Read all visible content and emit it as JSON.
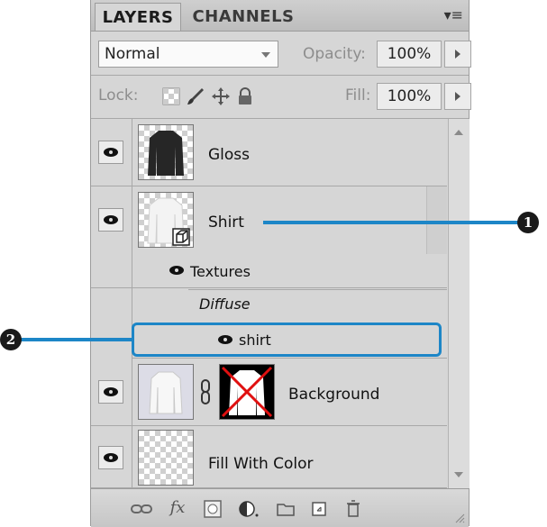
{
  "panel": {
    "tabs": [
      "LAYERS",
      "CHANNELS"
    ],
    "blend_mode": "Normal",
    "opacity_label": "Opacity:",
    "opacity_value": "100%",
    "lock_label": "Lock:",
    "fill_label": "Fill:",
    "fill_value": "100%"
  },
  "layers": [
    {
      "name": "Gloss",
      "visible": true
    },
    {
      "name": "Shirt",
      "visible": true,
      "smart_object": true,
      "sub": {
        "group": "Textures",
        "channel": "Diffuse",
        "texture": "shirt"
      }
    },
    {
      "name": "Background",
      "visible": true,
      "has_mask": true
    },
    {
      "name": "Fill With Color",
      "visible": true
    }
  ],
  "callouts": {
    "one": "1",
    "two": "2"
  },
  "colors": {
    "callout": "#1d86c7",
    "panel": "#d6d6d6"
  },
  "icons": [
    "eye-icon",
    "link-icon",
    "fx-icon",
    "mask-icon",
    "adjustment-icon",
    "folder-icon",
    "new-layer-icon",
    "trash-icon"
  ]
}
